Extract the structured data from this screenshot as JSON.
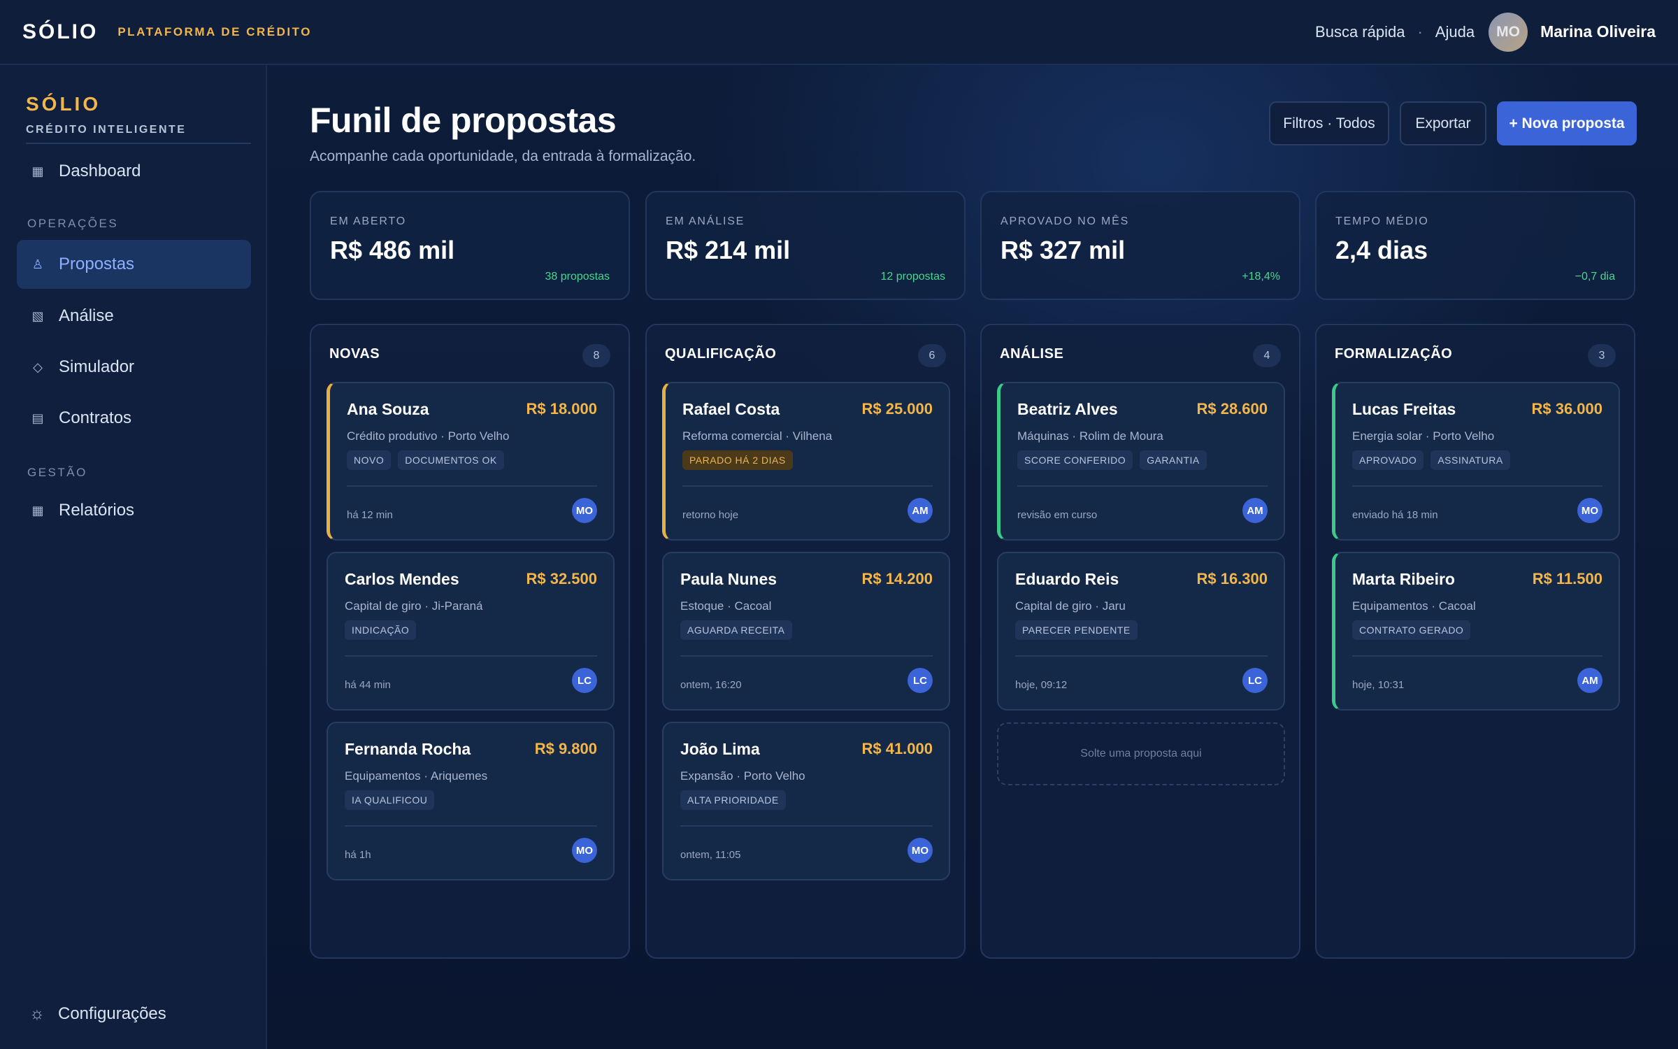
{
  "topbar": {
    "brand": "SÓLIO",
    "brand_sub": "PLATAFORMA DE CRÉDITO",
    "quick_search": "Busca rápida",
    "separator": "·",
    "help": "Ajuda",
    "user_initials": "MO",
    "user_name": "Marina Oliveira"
  },
  "sidebar": {
    "brand": "SÓLIO",
    "brand_sub": "CRÉDITO INTELIGENTE",
    "items": [
      {
        "label": "Dashboard",
        "icon": "grid-icon"
      },
      {
        "label": "Propostas",
        "icon": "person-icon"
      },
      {
        "label": "Análise",
        "icon": "hatched-square-icon"
      },
      {
        "label": "Simulador",
        "icon": "diamond-icon"
      },
      {
        "label": "Contratos",
        "icon": "document-icon"
      },
      {
        "label": "Relatórios",
        "icon": "table-icon"
      }
    ],
    "sections": {
      "operations": "OPERAÇÕES",
      "management": "GESTÃO"
    },
    "settings": "Configurações"
  },
  "header": {
    "title": "Funil de propostas",
    "subtitle": "Acompanhe cada oportunidade, da entrada à formalização.",
    "filters_label": "Filtros · Todos",
    "export_label": "Exportar",
    "new_label": "+ Nova proposta"
  },
  "kpis": [
    {
      "label": "EM ABERTO",
      "value": "R$ 486 mil",
      "note": "38 propostas"
    },
    {
      "label": "EM ANÁLISE",
      "value": "R$ 214 mil",
      "note": "12 propostas"
    },
    {
      "label": "APROVADO NO MÊS",
      "value": "R$ 327 mil",
      "note": "+18,4%"
    },
    {
      "label": "TEMPO MÉDIO",
      "value": "2,4 dias",
      "note": "−0,7 dia"
    }
  ],
  "columns": [
    {
      "title": "NOVAS",
      "count": "8",
      "cards": [
        {
          "name": "Ana Souza",
          "value": "R$ 18.000",
          "sub": "Crédito produtivo · Porto Velho",
          "tags": [
            "NOVO",
            "DOCUMENTOS OK"
          ],
          "time": "há 12 min",
          "avatar": "MO"
        },
        {
          "name": "Carlos Mendes",
          "value": "R$ 32.500",
          "sub": "Capital de giro · Ji-Paraná",
          "tags": [
            "INDICAÇÃO"
          ],
          "time": "há 44 min",
          "avatar": "LC"
        },
        {
          "name": "Fernanda Rocha",
          "value": "R$ 9.800",
          "sub": "Equipamentos · Ariquemes",
          "tags": [
            "IA QUALIFICOU"
          ],
          "time": "há 1h",
          "avatar": "MO"
        }
      ]
    },
    {
      "title": "QUALIFICAÇÃO",
      "count": "6",
      "cards": [
        {
          "name": "Rafael Costa",
          "value": "R$ 25.000",
          "sub": "Reforma comercial · Vilhena",
          "tags": [
            "PARADO HÁ 2 DIAS"
          ],
          "time": "retorno hoje",
          "avatar": "AM"
        },
        {
          "name": "Paula Nunes",
          "value": "R$ 14.200",
          "sub": "Estoque · Cacoal",
          "tags": [
            "AGUARDA RECEITA"
          ],
          "time": "ontem, 16:20",
          "avatar": "LC"
        },
        {
          "name": "João Lima",
          "value": "R$ 41.000",
          "sub": "Expansão · Porto Velho",
          "tags": [
            "ALTA PRIORIDADE"
          ],
          "time": "ontem, 11:05",
          "avatar": "MO"
        }
      ]
    },
    {
      "title": "ANÁLISE",
      "count": "4",
      "cards": [
        {
          "name": "Beatriz Alves",
          "value": "R$ 28.600",
          "sub": "Máquinas · Rolim de Moura",
          "tags": [
            "SCORE CONFERIDO",
            "GARANTIA"
          ],
          "time": "revisão em curso",
          "avatar": "AM"
        },
        {
          "name": "Eduardo Reis",
          "value": "R$ 16.300",
          "sub": "Capital de giro · Jaru",
          "tags": [
            "PARECER PENDENTE"
          ],
          "time": "hoje, 09:12",
          "avatar": "LC"
        }
      ],
      "dropzone": "Solte uma proposta aqui"
    },
    {
      "title": "FORMALIZAÇÃO",
      "count": "3",
      "cards": [
        {
          "name": "Lucas Freitas",
          "value": "R$ 36.000",
          "sub": "Energia solar · Porto Velho",
          "tags": [
            "APROVADO",
            "ASSINATURA"
          ],
          "time": "enviado há 18 min",
          "avatar": "MO"
        },
        {
          "name": "Marta Ribeiro",
          "value": "R$ 11.500",
          "sub": "Equipamentos · Cacoal",
          "tags": [
            "CONTRATO GERADO"
          ],
          "time": "hoje, 10:31",
          "avatar": "AM"
        }
      ]
    }
  ],
  "colors": {
    "accent_gold": "#f3b64a",
    "primary_blue": "#3b64d8",
    "positive_green": "#4ad68c",
    "warn_tag": "#f0b44c"
  }
}
